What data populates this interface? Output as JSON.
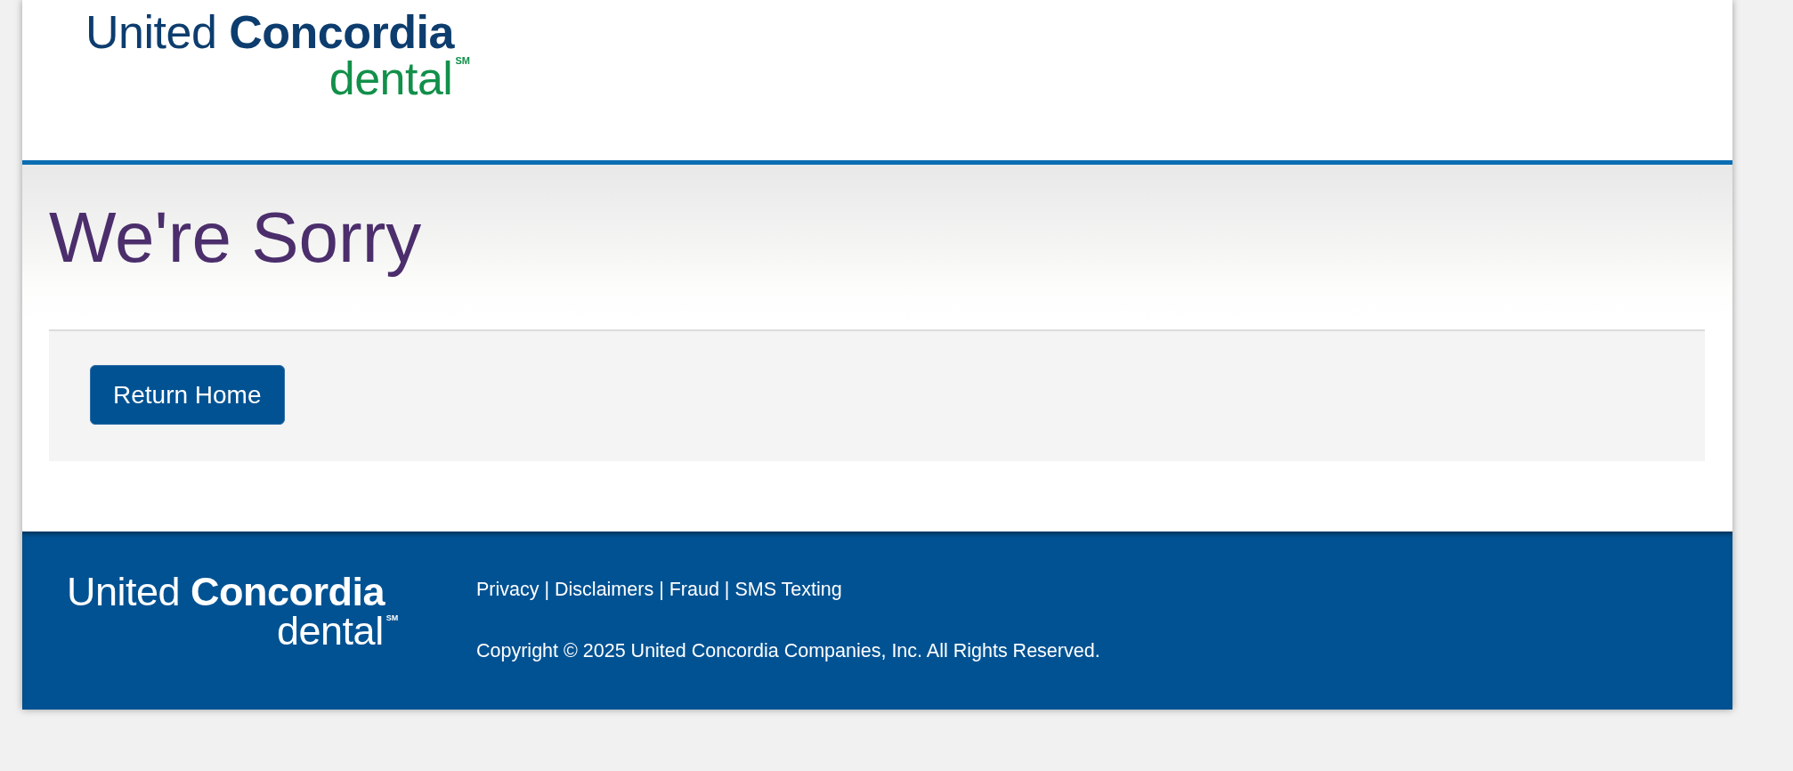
{
  "header": {
    "logo": {
      "name": "United **Concordia**",
      "product": "dental$^{SM}$"
    }
  },
  "content": {
    "heading": "We're Sorry",
    "button": {
      "label": "Return Home"
    }
  },
  "footer": {
    "logo": {
      "name": "United **Concordia**",
      "product": "dental$^{SM}$"
    },
    "links": [
      {
        "label": "Privacy",
        "separator": "|"
      },
      {
        "label": "Disclaimers",
        "separator": "|"
      },
      {
        "label": "Fraud",
        "separator": "|"
      },
      {
        "label": "SMS Texting"
      }
    ],
    "copyright": "Copyright © 2025 United Concordia Companies, Inc. All Rights Reserved."
  }
}
